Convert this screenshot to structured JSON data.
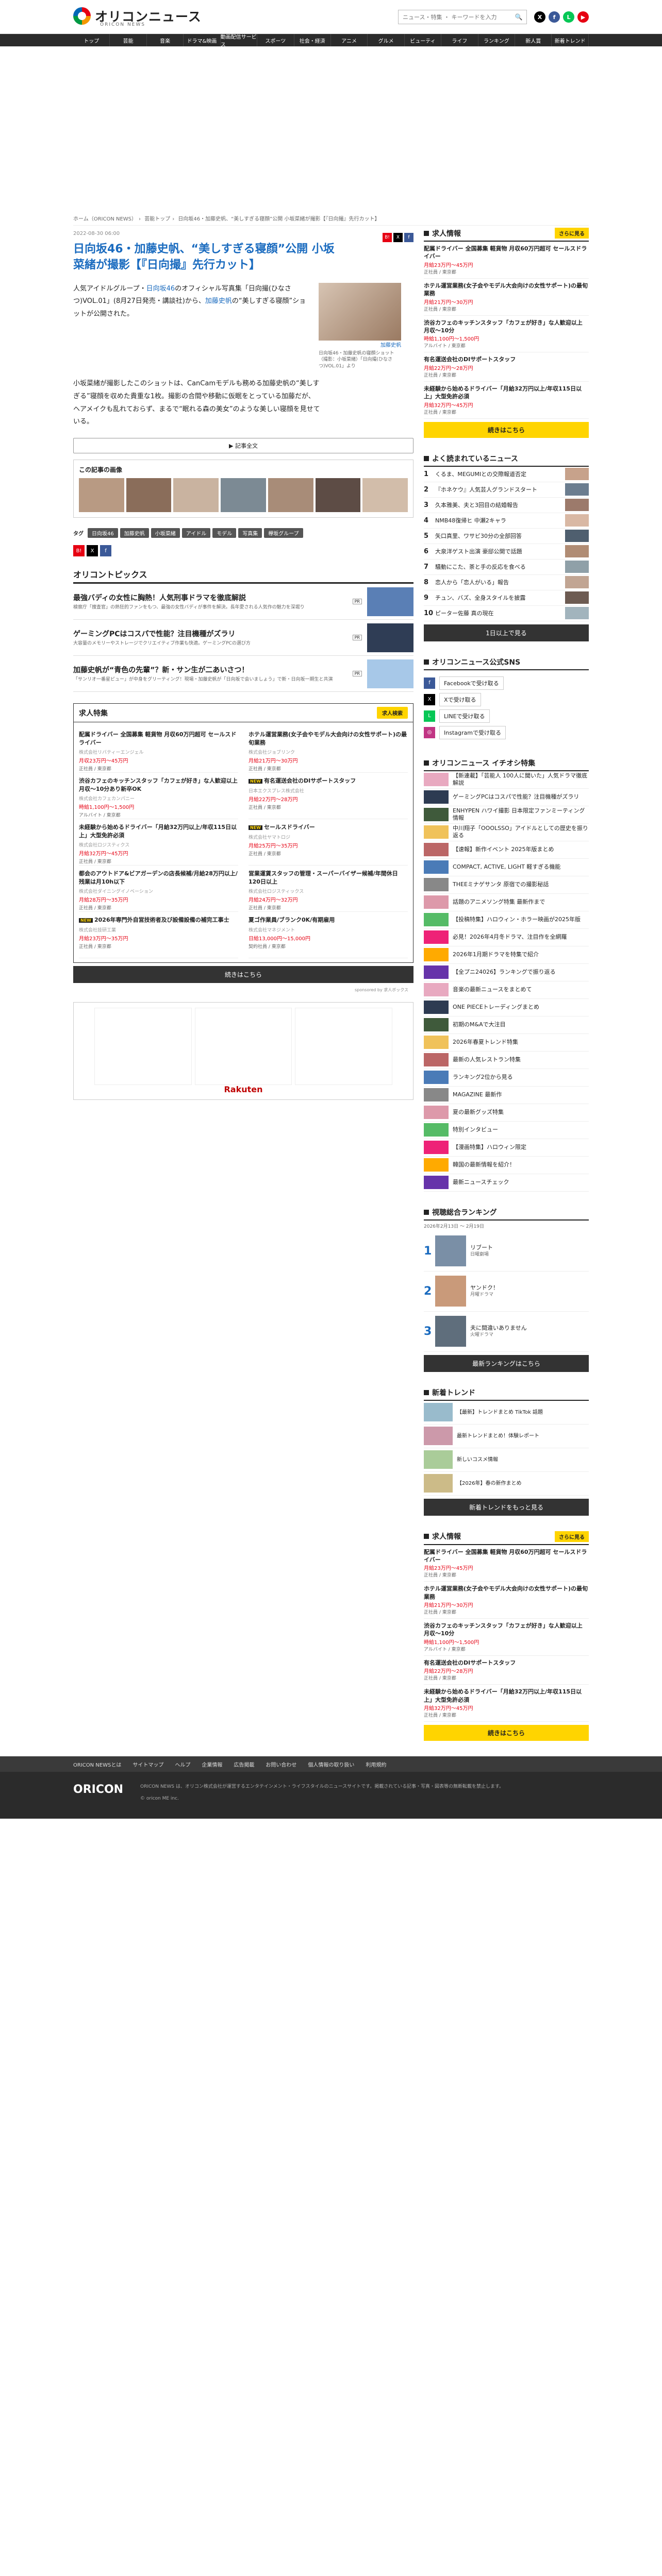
{
  "header": {
    "logo": "オリコンニュース",
    "logo_sub": "ORICON NEWS",
    "search_placeholder": "ニュース・特集 ・ キーワードを入力"
  },
  "gnav": [
    "トップ",
    "芸能",
    "音楽",
    "ドラマ&映画",
    "動画配信サービス",
    "スポーツ",
    "社会・経済",
    "アニメ",
    "グルメ",
    "ビューティ",
    "ライフ",
    "ランキング",
    "新人賞",
    "新着トレンド"
  ],
  "breadcrumb": [
    "ホーム（ORICON NEWS）",
    "芸能トップ",
    "日向坂46・加藤史帆、“美しすぎる寝顔”公開 小坂菜緒が撮影【『日向撮』先行カット】"
  ],
  "article": {
    "date": "2022-08-30 06:00",
    "title": "日向坂46・加藤史帆、“美しすぎる寝顔”公開 小坂菜緒が撮影【『日向撮』先行カット】",
    "lead_pre": "人気アイドルグループ・",
    "lead_link1": "日向坂46",
    "lead_mid": "のオフィシャル写真集「日向撮(ひなさつ)VOL.01」(8月27日発売・講談社)から、",
    "lead_link2": "加藤史帆",
    "lead_post": "の“美しすぎる寝顔”ショットが公開された。",
    "photo_name": "加藤史帆",
    "photo_caption": "日向坂46・加藤史帆の寝顔ショット（撮影：小坂菜緒）「日向撮(ひなさつ)VOL.01」より",
    "body": "小坂菜緒が撮影したこのショットは、CanCamモデルも務める加藤史帆の“美しすぎる”寝顔を収めた貴重な1枚。撮影の合間や移動に仮眠をとっている加藤だが、ヘアメイクも乱れておらず、まるで“眠れる森の美女”のような美しい寝顔を見せている。",
    "all_article": "記事全文",
    "photo_box_title": "この記事の画像",
    "tags_label": "タグ",
    "tags": [
      "日向坂46",
      "加藤史帆",
      "小坂菜緒",
      "アイドル",
      "モデル",
      "写真集",
      "欅坂グループ"
    ]
  },
  "topics": {
    "title": "オリコントピックス",
    "items": [
      {
        "t": "最強バディの女性に胸熱！人気刑事ドラマを徹底解説",
        "d": "検察庁「捜査官」の熱狂的ファンをもつ、最強の女性バディが事件を解決。長年愛される人気作の魅力を深堀り",
        "pr": "PR"
      },
      {
        "t": "ゲーミングPCはコスパで性能？注目機種がズラリ",
        "d": "大容量のメモリーやストレージでクリエイティブ作業も快適。ゲーミングPCの選び方",
        "pr": "PR"
      },
      {
        "t": "加藤史帆が“青色の先輩”？新・サン生が二あいさつ！",
        "d": "「サンリオ一番星ピュー」が中身をグリーティング！現場・加藤史帆が「日向坂で会いましょう」で新・日向坂一期生と共演",
        "pr": "PR"
      }
    ]
  },
  "jobs": {
    "title": "求人特集",
    "more": "求人検索",
    "list": [
      {
        "t": "配属ドライバー 全国募集 軽貨物 月収60万円超可 セールスドライバー",
        "co": "株式会社リバティーエンジェル",
        "pay": "月収23万円～45万円",
        "loc": "正社員 / 東京都"
      },
      {
        "t": "ホテル運営業務(女子会やモデル大会向けの女性サポート)の最旬業務",
        "co": "株式会社ジョブリンク",
        "pay": "月給21万円～30万円",
        "loc": "正社員 / 東京都"
      },
      {
        "t": "渋谷カフェのキッチンスタッフ「カフェが好き」な人歓迎以上 月収～10分あり新卒OK",
        "co": "株式会社カフェカンパニー",
        "pay": "時給1,100円～1,500円",
        "loc": "アルバイト / 東京都"
      },
      {
        "t": "有名運送会社のDIサポートスタッフ",
        "co": "日本エクスプレス株式会社",
        "pay": "月給22万円～28万円",
        "loc": "正社員 / 東京都",
        "new": true
      },
      {
        "t": "未経験から始めるドライバー「月給32万円以上/年収115日以上」大型免許必須",
        "co": "株式会社ロジスティクス",
        "pay": "月給32万円～45万円",
        "loc": "正社員 / 東京都"
      },
      {
        "t": "セールスドライバー",
        "co": "株式会社ヤマトロジ",
        "pay": "月給25万円～35万円",
        "loc": "正社員 / 東京都",
        "new": true
      },
      {
        "t": "都会のアウトドア&ビアガーデンの店長候補/月給28万円以上/残業は月10h以下",
        "co": "株式会社ダイニングイノベーション",
        "pay": "月給28万円～35万円",
        "loc": "正社員 / 東京都"
      },
      {
        "t": "営業運賃スタッフの管理・スーパーバイザー候補/年間休日120日以上",
        "co": "株式会社ロジスティックス",
        "pay": "月給24万円～32万円",
        "loc": "正社員 / 東京都"
      },
      {
        "t": "2026年専門外自営技術者及び設備設備の補完工事士",
        "co": "株式会社技研工業",
        "pay": "月給23万円～35万円",
        "loc": "正社員 / 東京都",
        "new": true
      },
      {
        "t": "夏ゴ作業員/ブランク0K/有期雇用",
        "co": "株式会社マネジメント",
        "pay": "日給13,000円～15,000円",
        "loc": "契約社員 / 東京都"
      }
    ],
    "more_btn": "続きはこちら",
    "foot": "sponsored by 求人ボックス"
  },
  "side": {
    "jobs_title": "求人情報",
    "jobs_more": "さらに見る",
    "jobs": [
      {
        "t": "配属ドライバー 全国募集 軽貨物 月収60万円超可 セールスドライバー",
        "pay": "月給23万円～45万円",
        "loc": "正社員 / 東京都"
      },
      {
        "t": "ホテル運営業務(女子会やモデル大会向けの女性サポート)の最旬業務",
        "pay": "月給21万円～30万円",
        "loc": "正社員 / 東京都"
      },
      {
        "t": "渋谷カフェのキッチンスタッフ「カフェが好き」な人歓迎以上 月収～10分",
        "pay": "時給1,100円～1,500円",
        "loc": "アルバイト / 東京都"
      },
      {
        "t": "有名運送会社のDIサポートスタッフ",
        "pay": "月給22万円～28万円",
        "loc": "正社員 / 東京都"
      },
      {
        "t": "未経験から始めるドライバー「月給32万円以上/年収115日以上」大型免許必須",
        "pay": "月給32万円～45万円",
        "loc": "正社員 / 東京都"
      }
    ],
    "jobs_btn": "続きはこちら",
    "ranking_title": "よく読まれているニュース",
    "ranking": [
      "くるま、MEGUMIとの交際報道否定",
      "『ホネケウ』人気芸人グランドスタート",
      "久本雅美、夫と3回目の結婚報告",
      "NMB48復帰ヒ 中瀬2キャラ",
      "矢口真里、ワサビ30分の全部回答",
      "大泉洋ゲスト出演 豪邸公開で話題",
      "騒動にこた、茶と手の反応を食べる",
      "恋人から「恋人がいる」報告",
      "チュン、バズ、全身スタイルを披露",
      "ピーター佐藤 真の現在"
    ],
    "ranking_more": "1日以上で見る",
    "sns_title": "オリコンニュース公式SNS",
    "sns": [
      {
        "n": "Facebookで受け取る",
        "c": "#3b5998",
        "i": "f"
      },
      {
        "n": "Xで受け取る",
        "c": "#000000",
        "i": "X"
      },
      {
        "n": "LINEで受け取る",
        "c": "#06c755",
        "i": "L"
      },
      {
        "n": "Instagramで受け取る",
        "c": "#c13584",
        "i": "◎"
      }
    ],
    "feature_title": "オリコンニュース イチオシ特集",
    "features": [
      "【新連載】「芸能人 100人に聞いた」人気ドラマ徹底解説",
      "ゲーミングPCはコスパで性能？注目機種がズラリ",
      "ENHYPEN ハワイ撮影 日本限定ファンミーティング情報",
      "中川翔子「OOOLSSO」アイドルとしての歴史を振り返る",
      "【速報】新作イベント 2025年版まとめ",
      "COMPACT, ACTIVE, LIGHT 軽すぎる機能",
      "THEEミナゲサンタ 原宿での撮影秘話",
      "話題のアニメソング特集 最新作まで",
      "【投稿特集】ハロウィン・ホラー映画が2025年版",
      "必見！2026年4月冬ドラマ、注目作を全網羅",
      "2026年1月期ドラマを特集で紹介",
      "【全プニ24026】ランキングで振り返る",
      "音楽の最新ニュースをまとめて",
      "ONE PIECEトレーディングまとめ",
      "初期のM&Aで大注目",
      "2026年春夏トレンド特集",
      "最新の人気レストラン特集",
      "ランキング2位から見る",
      "MAGAZINE 最新作",
      "夏の最新グッズ特集",
      "特別インタビュー",
      "【漫画特集】ハロウィン限定",
      "韓国の最新情報を紹介！",
      "最新ニュースチェック"
    ],
    "tv_title": "視聴総合ランキング",
    "tv_sub": "2026年2月13日 ～ 2月19日",
    "tv": [
      {
        "t": "リブート",
        "s": "日曜劇場"
      },
      {
        "t": "ヤンドク！",
        "s": "月曜ドラマ"
      },
      {
        "t": "夫に間違いありません",
        "s": "火曜ドラマ"
      }
    ],
    "tv_more": "最新ランキングはこちら",
    "trend_title": "新着トレンド",
    "trends": [
      "【最新】トレンドまとめ TikTok 話題",
      "最新トレンドまとめ！体験レポート",
      "新しいコスメ情報",
      "【2026年】春の新作まとめ"
    ],
    "trend_more": "新着トレンドをもっと見る"
  },
  "footer": {
    "nav": [
      "ORICON NEWSとは",
      "サイトマップ",
      "ヘルプ",
      "企業情報",
      "広告掲載",
      "お問い合わせ",
      "個人情報の取り扱い",
      "利用規約"
    ],
    "logo": "ORICON",
    "text": "ORICON NEWS は、オリコン株式会社が運営するエンタテインメント・ライフスタイルのニュースサイトです。掲載されている記事・写真・図表等の無断転載を禁止します。",
    "copy": "© oricon ME inc."
  }
}
